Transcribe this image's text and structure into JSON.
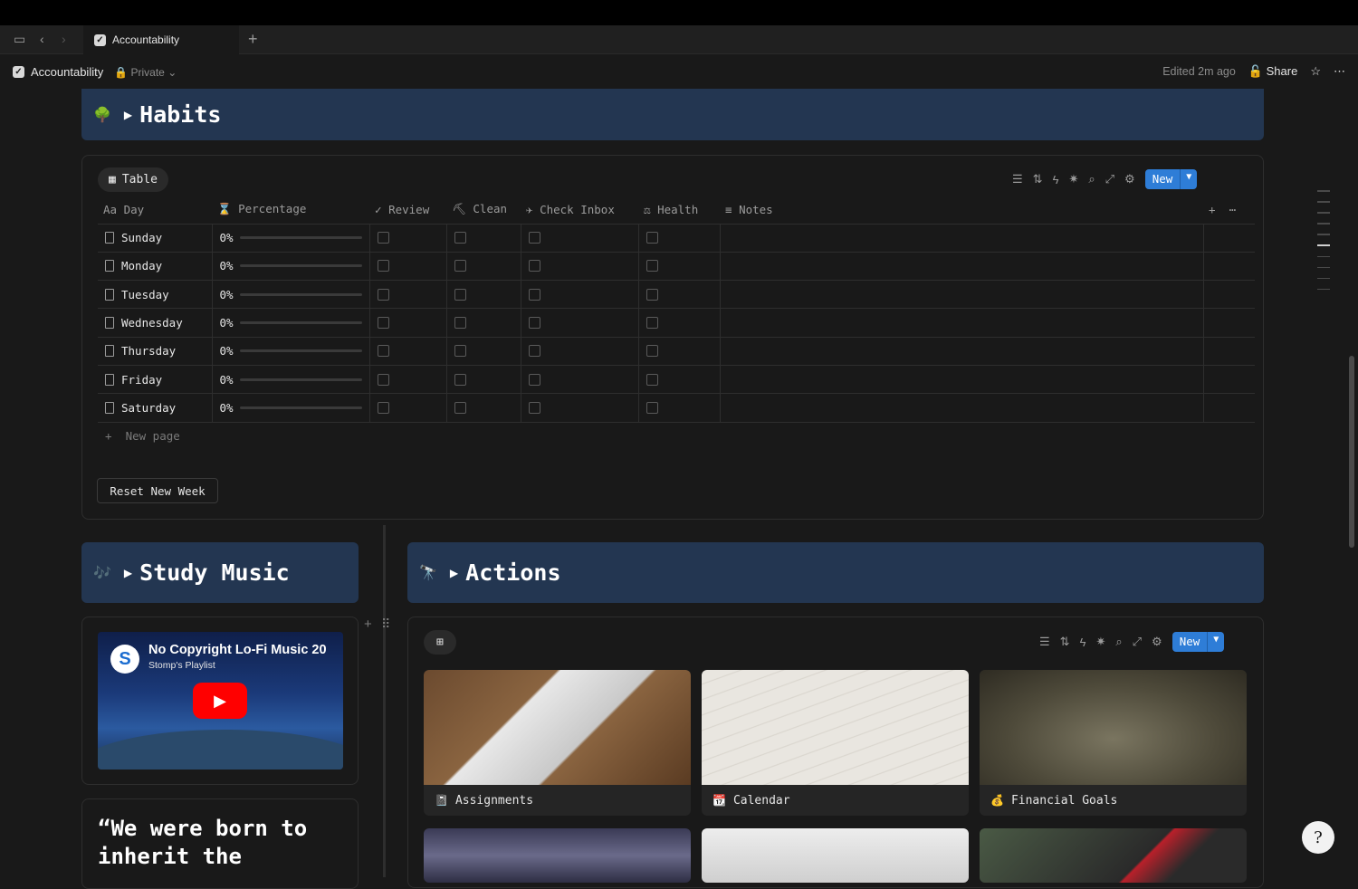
{
  "tabbar": {
    "tab_title": "Accountability",
    "add_icon": "plus-icon"
  },
  "header": {
    "breadcrumb": "Accountability",
    "privacy": "Private",
    "edited": "Edited 2m ago",
    "share": "Share"
  },
  "habits": {
    "emoji": "🌳",
    "title": "Habits",
    "view_tab": "Table",
    "new_label": "New",
    "columns": [
      "Day",
      "Percentage",
      "Review",
      "Clean",
      "Check Inbox",
      "Health",
      "Notes"
    ],
    "column_icons": [
      "Aa",
      "⌛",
      "✓",
      "⛏",
      "✈",
      "⚖",
      "≡"
    ],
    "rows": [
      {
        "day": "Sunday",
        "pct": "0%",
        "progress": 0
      },
      {
        "day": "Monday",
        "pct": "0%",
        "progress": 0
      },
      {
        "day": "Tuesday",
        "pct": "0%",
        "progress": 0
      },
      {
        "day": "Wednesday",
        "pct": "0%",
        "progress": 0
      },
      {
        "day": "Thursday",
        "pct": "0%",
        "progress": 0
      },
      {
        "day": "Friday",
        "pct": "0%",
        "progress": 0
      },
      {
        "day": "Saturday",
        "pct": "0%",
        "progress": 0
      }
    ],
    "new_page": "New page",
    "reset_button": "Reset New Week"
  },
  "study_music": {
    "emoji": "🎶",
    "title": "Study Music",
    "video_title": "No Copyright Lo-Fi Music 20",
    "video_channel": "Stomp's Playlist",
    "quote": "“We were born to inherit the"
  },
  "actions": {
    "emoji": "🔭",
    "title": "Actions",
    "new_label": "New",
    "cards": [
      {
        "title": "Assignments",
        "icon": "📓"
      },
      {
        "title": "Calendar",
        "icon": "📆"
      },
      {
        "title": "Financial Goals",
        "icon": "💰"
      }
    ]
  }
}
